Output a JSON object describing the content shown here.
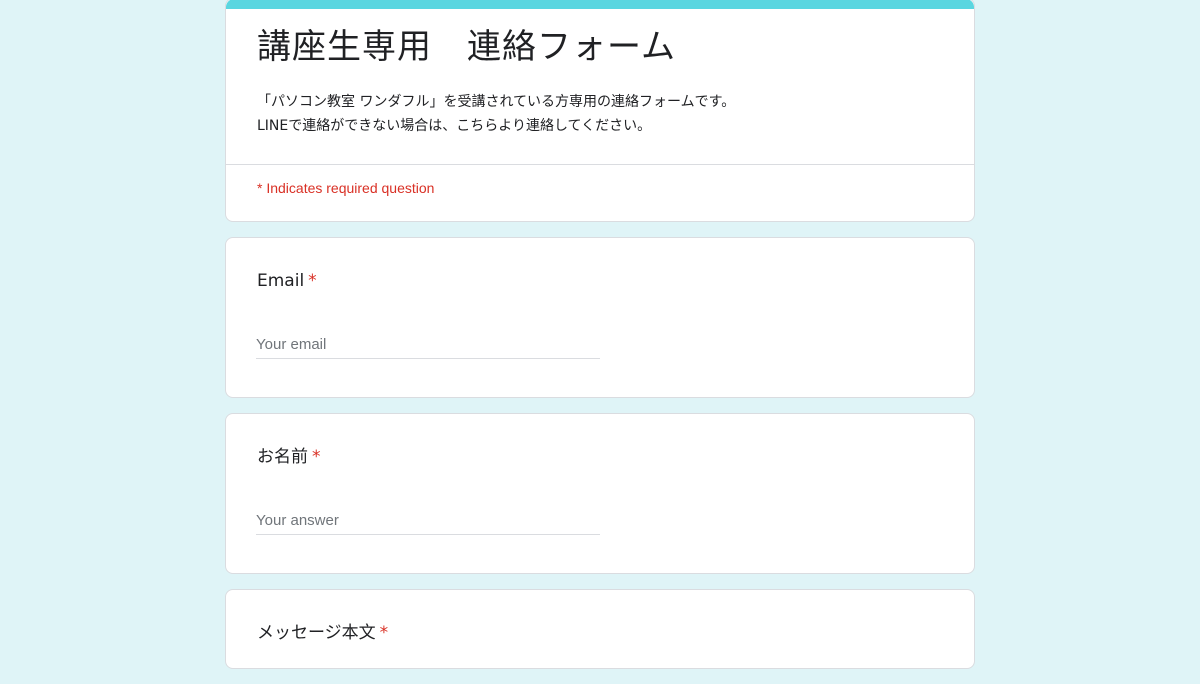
{
  "theme": {
    "accent": "#5ad6e0",
    "background": "#dff4f7",
    "required_color": "#d93025"
  },
  "header": {
    "title": "講座生専用　連絡フォーム",
    "description_line1": "「パソコン教室 ワンダフル」を受講されている方専用の連絡フォームです。",
    "description_line2": "LINEで連絡ができない場合は、こちらより連絡してください。",
    "required_note": "* Indicates required question"
  },
  "questions": [
    {
      "label": "Email",
      "required_mark": "*",
      "placeholder": "Your email"
    },
    {
      "label": "お名前",
      "required_mark": "*",
      "placeholder": "Your answer"
    },
    {
      "label": "メッセージ本文",
      "required_mark": "*"
    }
  ]
}
